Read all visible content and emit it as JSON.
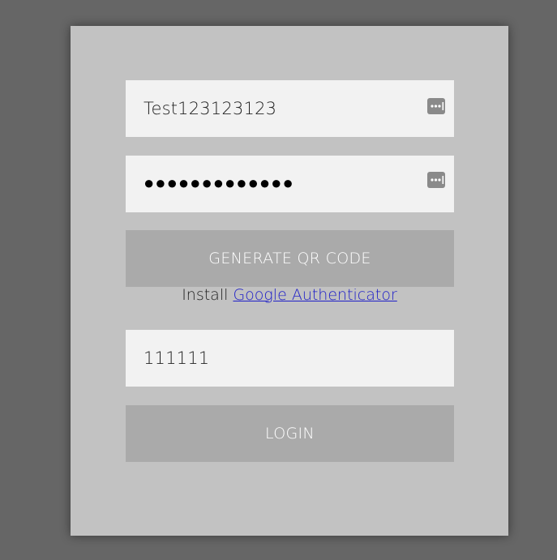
{
  "form": {
    "username_value": "Test123123123",
    "password_masked": "●●●●●●●●●●●●●",
    "password_manager_icon": "password-manager-icon",
    "generate_qr_label": "GENERATE QR CODE",
    "install_prefix": "Install",
    "install_link_text": "Google Authenticator",
    "code_value": "111111",
    "login_label": "LOGIN"
  },
  "colors": {
    "page_background": "#666666",
    "panel_background": "#c2c2c2",
    "field_background": "#f2f2f2",
    "button_background": "#aaaaaa",
    "button_text": "#ffffff",
    "link": "#2020c8"
  }
}
